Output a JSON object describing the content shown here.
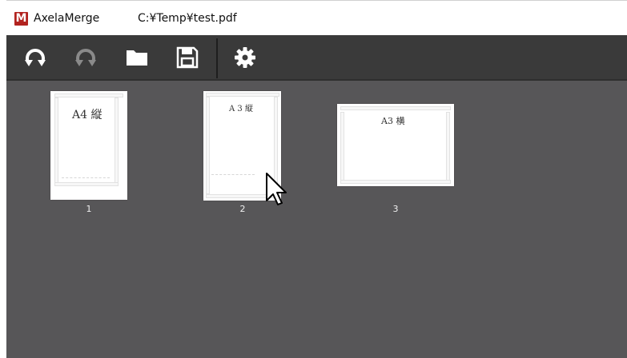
{
  "titlebar": {
    "logo_letter": "M",
    "app_name": "AxelaMerge",
    "file_path": "C:¥Temp¥test.pdf"
  },
  "toolbar": {
    "buttons": [
      {
        "icon": "rotate-left-icon",
        "enabled": true
      },
      {
        "icon": "rotate-right-icon",
        "enabled": false
      },
      {
        "icon": "folder-icon",
        "enabled": true
      },
      {
        "icon": "save-icon",
        "enabled": true
      },
      {
        "icon": "gear-icon",
        "enabled": true
      }
    ]
  },
  "pages": [
    {
      "label": "A4 縦",
      "number": "1"
    },
    {
      "label": "A 3 縦",
      "number": "2"
    },
    {
      "label": "A3 横",
      "number": "3"
    }
  ],
  "colors": {
    "logo": "#b2231f",
    "toolbar_bg": "#3a3a3a",
    "content_bg": "#575658",
    "icon_enabled": "#ffffff",
    "icon_disabled": "#8a8a8a"
  }
}
